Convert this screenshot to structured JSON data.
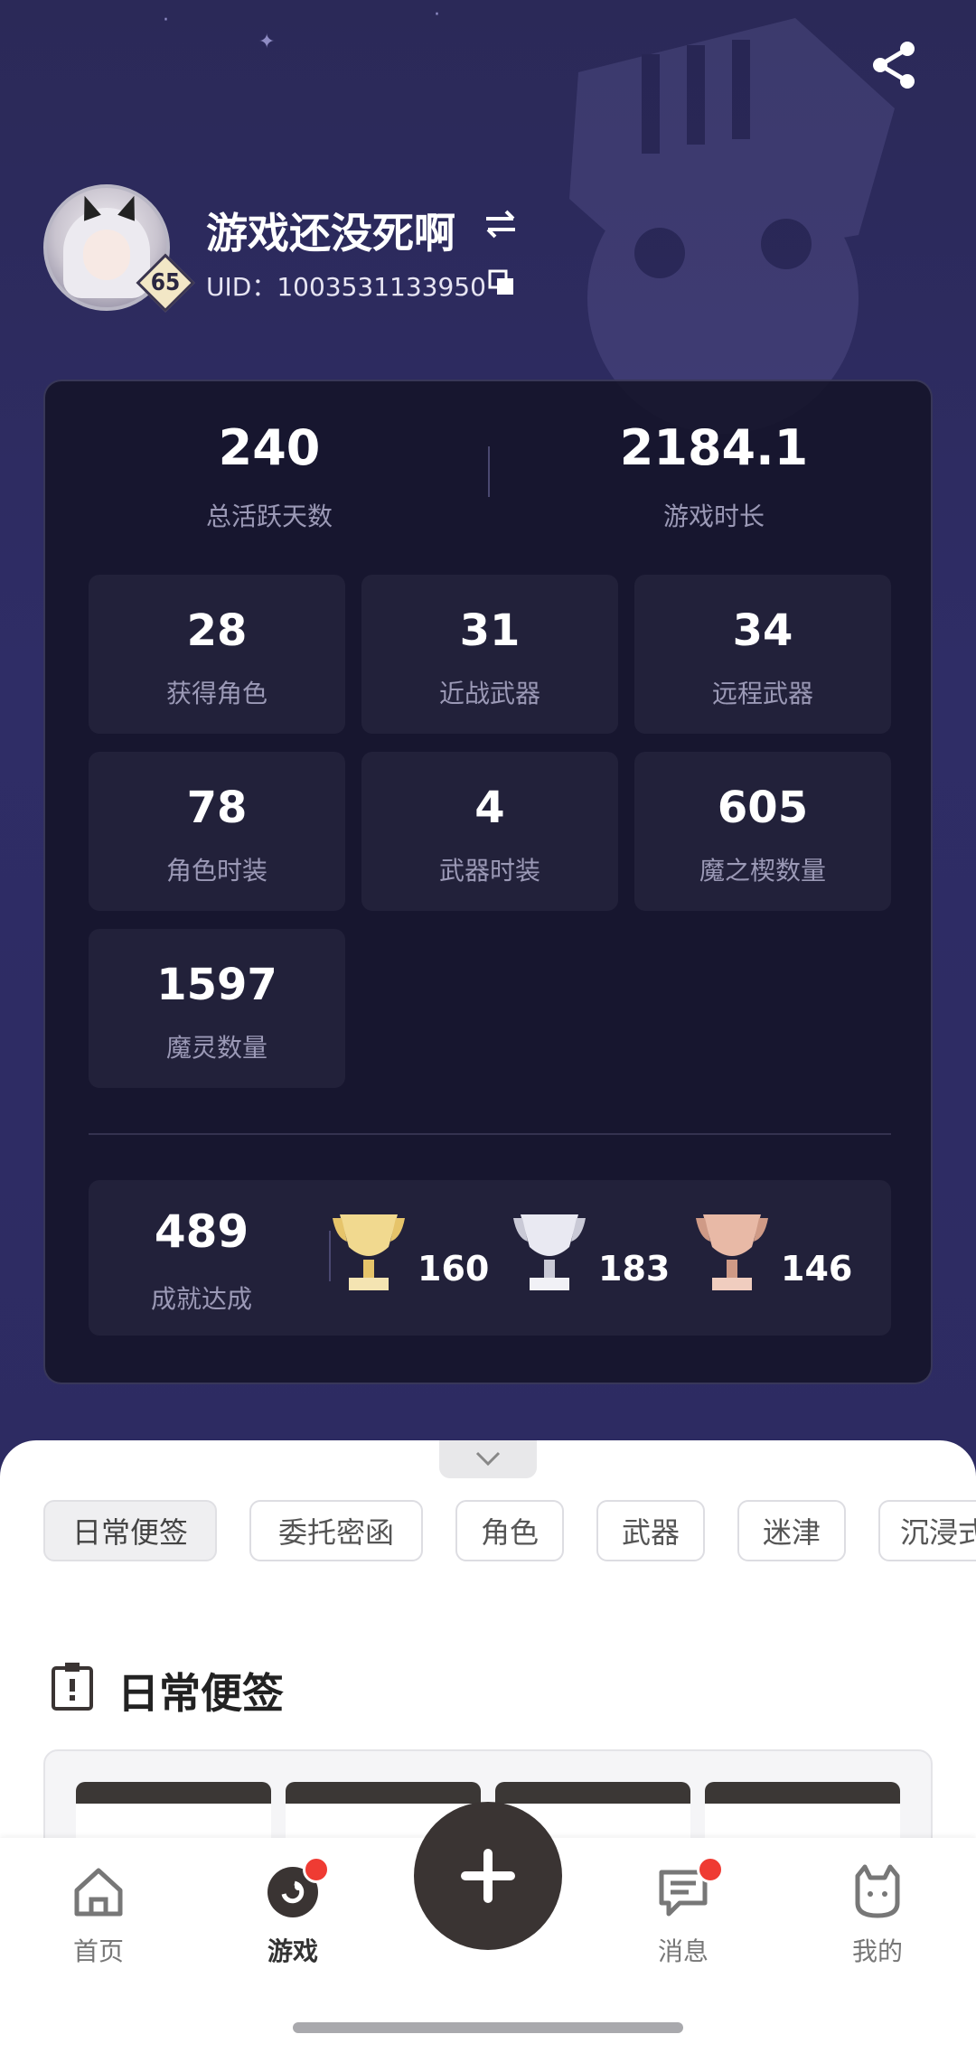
{
  "profile": {
    "username": "游戏还没死啊",
    "uid": "UID：1003531133950",
    "level": "65"
  },
  "stats": {
    "active_days": {
      "value": "240",
      "label": "总活跃天数"
    },
    "play_time": {
      "value": "2184.1",
      "label": "游戏时长"
    },
    "tiles": [
      {
        "value": "28",
        "label": "获得角色"
      },
      {
        "value": "31",
        "label": "近战武器"
      },
      {
        "value": "34",
        "label": "远程武器"
      },
      {
        "value": "78",
        "label": "角色时装"
      },
      {
        "value": "4",
        "label": "武器时装"
      },
      {
        "value": "605",
        "label": "魔之楔数量"
      },
      {
        "value": "1597",
        "label": "魔灵数量"
      }
    ],
    "achievements": {
      "value": "489",
      "label": "成就达成",
      "gold": "160",
      "silver": "183",
      "bronze": "146"
    }
  },
  "chips": [
    "日常便签",
    "委托密函",
    "角色",
    "武器",
    "迷津",
    "沉浸式"
  ],
  "section": {
    "title": "日常便签"
  },
  "tabbar": {
    "home": "首页",
    "game": "游戏",
    "messages": "消息",
    "mine": "我的"
  },
  "colors": {
    "hero_bg": "#2c2a5e",
    "card_bg": "#14132a",
    "tile_bg": "#22213a",
    "badge_red": "#ef3b33",
    "plus_btn": "#3a3433"
  }
}
